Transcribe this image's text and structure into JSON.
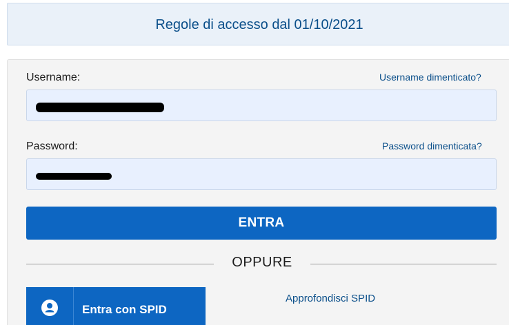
{
  "notice": {
    "label": "Regole di accesso dal 01/10/2021"
  },
  "login": {
    "username": {
      "label": "Username:",
      "forgot_label": "Username dimenticato?",
      "value": ""
    },
    "password": {
      "label": "Password:",
      "forgot_label": "Password dimenticata?",
      "value": ""
    },
    "submit_label": "ENTRA",
    "separator_label": "OPPURE",
    "spid": {
      "button_label": "Entra con SPID",
      "icon": "user-icon",
      "info_label": "Approfondisci SPID"
    }
  },
  "colors": {
    "primary": "#0d66c2",
    "link": "#0b4f8a",
    "notice_background": "#eaf1f9",
    "panel_background": "#f4f4f4",
    "input_background": "#e8f0fe"
  }
}
